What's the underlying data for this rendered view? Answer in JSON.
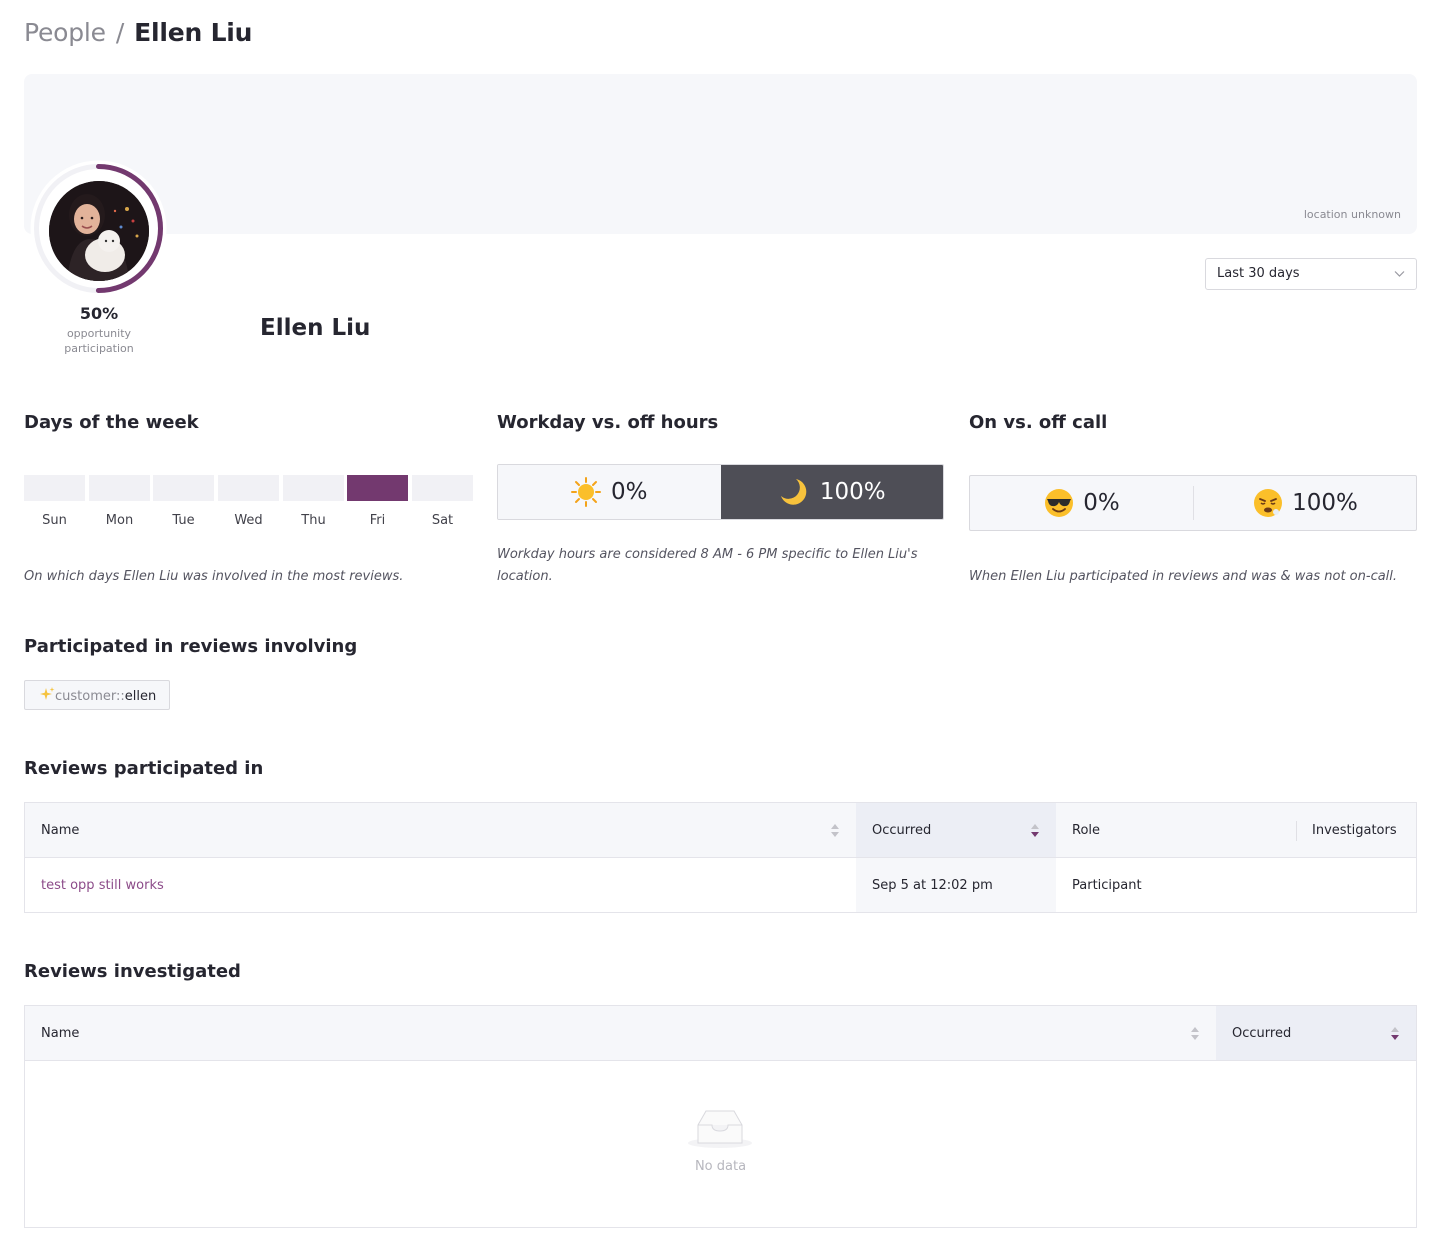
{
  "breadcrumb": {
    "root": "People",
    "separator": "/",
    "current": "Ellen Liu"
  },
  "banner": {
    "location": "location unknown"
  },
  "profile": {
    "name": "Ellen Liu",
    "participation_pct": "50%",
    "participation_value": 0.5,
    "participation_caption_1": "opportunity",
    "participation_caption_2": "participation"
  },
  "range_select": {
    "value": "Last 30 days",
    "icon": "chevron-down-icon"
  },
  "days_of_week": {
    "title": "Days of the week",
    "days": [
      {
        "label": "Sun",
        "active": false
      },
      {
        "label": "Mon",
        "active": false
      },
      {
        "label": "Tue",
        "active": false
      },
      {
        "label": "Wed",
        "active": false
      },
      {
        "label": "Thu",
        "active": false
      },
      {
        "label": "Fri",
        "active": true
      },
      {
        "label": "Sat",
        "active": false
      }
    ],
    "note": "On which days Ellen Liu was involved in the most reviews."
  },
  "workday": {
    "title": "Workday vs. off hours",
    "workday_pct": "0%",
    "offhours_pct": "100%",
    "note": "Workday hours are considered 8 AM - 6 PM specific to Ellen Liu's location."
  },
  "oncall": {
    "title": "On vs. off call",
    "off_call_pct": "0%",
    "on_call_pct": "100%",
    "note": "When Ellen Liu participated in reviews and was & was not on-call."
  },
  "involving": {
    "title": "Participated in reviews involving",
    "tag_prefix": "customer::",
    "tag_value": "ellen",
    "tag_icon": "sparkles-icon"
  },
  "participated_table": {
    "title": "Reviews participated in",
    "columns": [
      "Name",
      "Occurred",
      "Role",
      "Investigators"
    ],
    "rows": [
      {
        "name": "test opp still works",
        "occurred": "Sep 5 at 12:02 pm",
        "role": "Participant",
        "investigators": ""
      }
    ]
  },
  "investigated_table": {
    "title": "Reviews investigated",
    "columns": [
      "Name",
      "Occurred"
    ],
    "empty_text": "No data"
  },
  "colors": {
    "accent": "#73396f",
    "link": "#8c4b89",
    "night": "#4e4e56"
  }
}
